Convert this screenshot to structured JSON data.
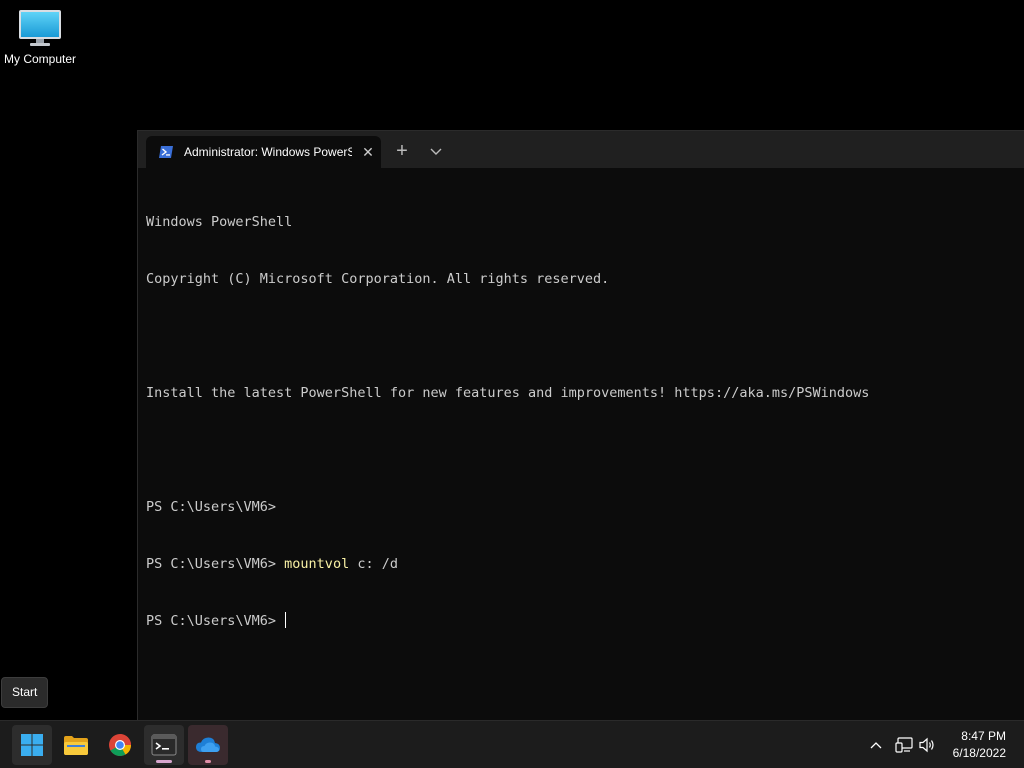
{
  "desktop": {
    "icons": [
      {
        "label": "My Computer",
        "icon": "monitor-icon"
      }
    ]
  },
  "terminal": {
    "tab_title": "Administrator: Windows PowerShell",
    "tab_close": "✕",
    "new_tab": "+",
    "lines": [
      {
        "text": "Windows PowerShell"
      },
      {
        "text": "Copyright (C) Microsoft Corporation. All rights reserved."
      },
      {
        "text": ""
      },
      {
        "text": "Install the latest PowerShell for new features and improvements! https://aka.ms/PSWindows"
      },
      {
        "text": ""
      },
      {
        "text": "PS C:\\Users\\VM6>"
      }
    ],
    "command_line": {
      "prompt": "PS C:\\Users\\VM6> ",
      "command": "mountvol",
      "args": " c: /d"
    },
    "current_prompt": "PS C:\\Users\\VM6> "
  },
  "tooltip": {
    "label": "Start"
  },
  "taskbar": {
    "apps": [
      {
        "name": "start",
        "icon": "windows-logo-icon"
      },
      {
        "name": "file-explorer",
        "icon": "folder-icon"
      },
      {
        "name": "chrome",
        "icon": "chrome-icon"
      },
      {
        "name": "terminal",
        "icon": "terminal-icon"
      },
      {
        "name": "onedrive",
        "icon": "cloud-icon"
      }
    ],
    "tray": {
      "chevron": "chevron-up-icon",
      "network": "network-icon",
      "volume": "volume-icon"
    },
    "clock": {
      "time": "8:47 PM",
      "date": "6/18/2022"
    }
  },
  "colors": {
    "terminal_bg": "#0c0c0c",
    "terminal_text": "#cccccc",
    "command_highlight": "#f9f1a5",
    "taskbar_bg": "#1c1c1c"
  }
}
